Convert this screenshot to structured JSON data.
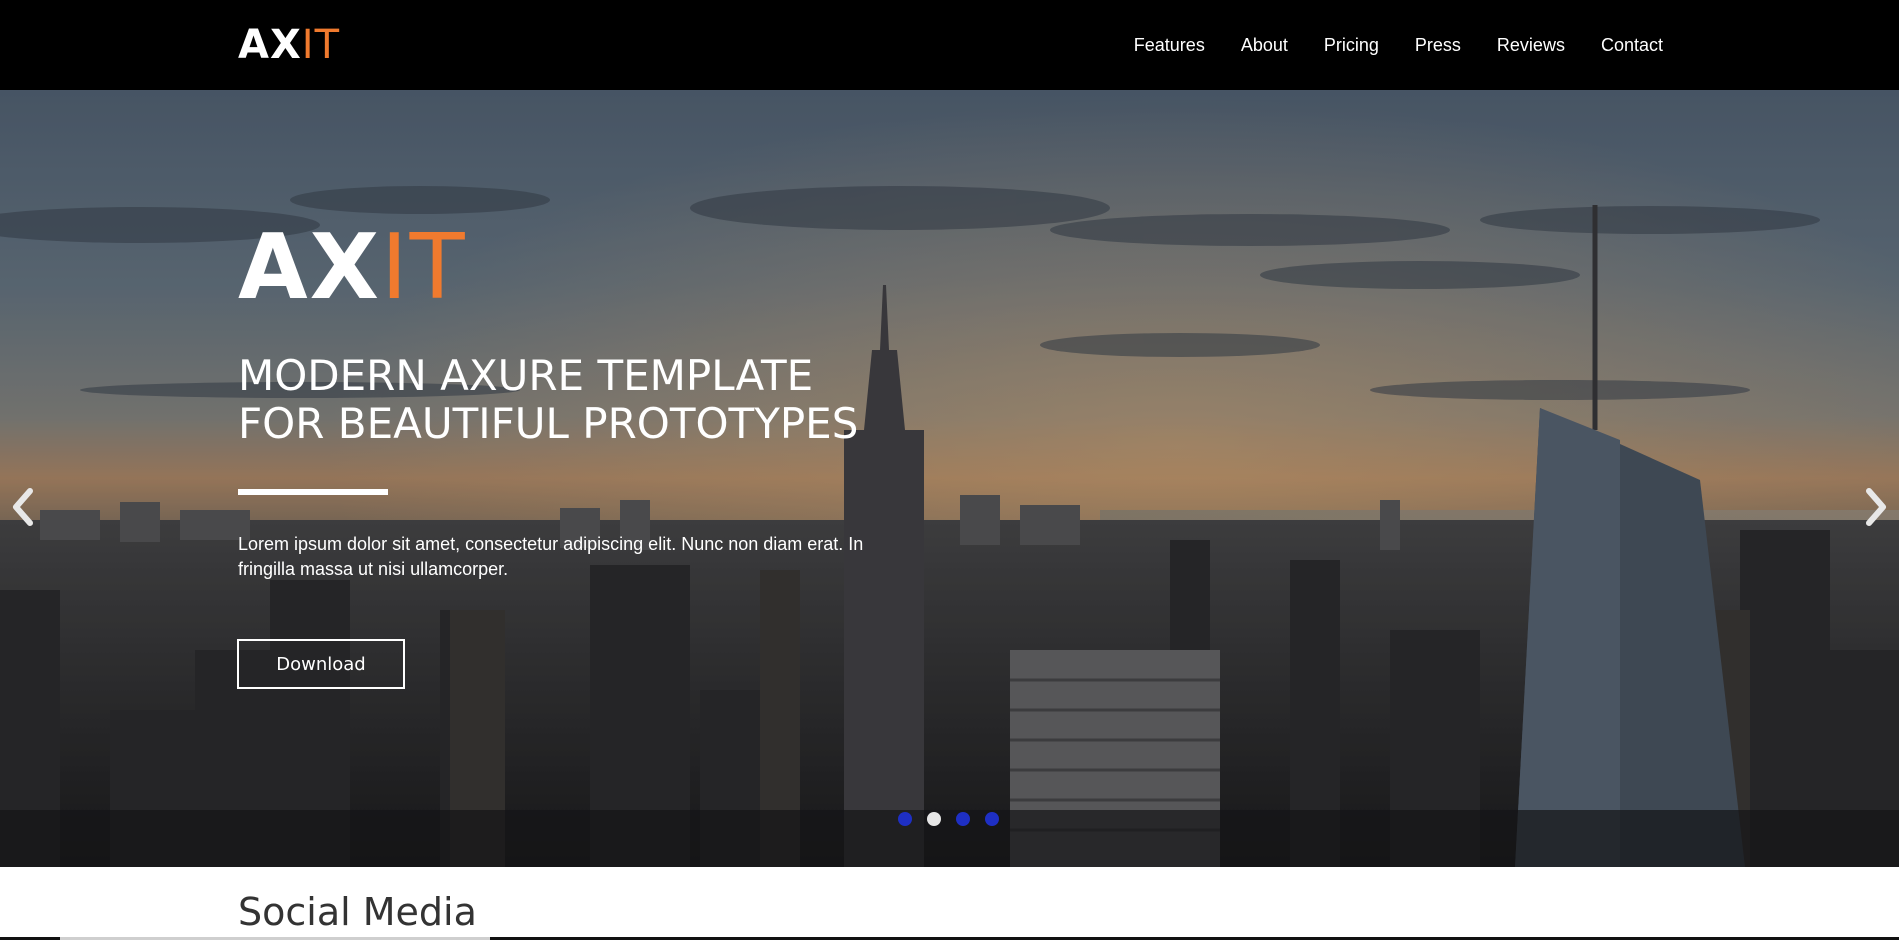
{
  "brand": {
    "logo_main": "AX",
    "logo_accent": "IT",
    "accent_color": "#f07a2e"
  },
  "nav": {
    "items": [
      {
        "label": "Features"
      },
      {
        "label": "About"
      },
      {
        "label": "Pricing"
      },
      {
        "label": "Press"
      },
      {
        "label": "Reviews"
      },
      {
        "label": "Contact"
      }
    ]
  },
  "hero": {
    "logo_main": "AX",
    "logo_accent": "IT",
    "title_line1": "MODERN AXURE TEMPLATE",
    "title_line2": "FOR BEAUTIFUL PROTOTYPES",
    "text": "Lorem ipsum dolor sit amet, consectetur adipiscing elit. Nunc non diam erat. In fringilla massa ut nisi ullamcorper.",
    "download_label": "Download",
    "slides": {
      "count": 4,
      "active_index": 1
    },
    "dot_color": "#1e2fc4",
    "dot_active_color": "#e6e6e6"
  },
  "social": {
    "heading": "Social Media"
  },
  "icons": {
    "prev": "chevron-left-icon",
    "next": "chevron-right-icon"
  }
}
